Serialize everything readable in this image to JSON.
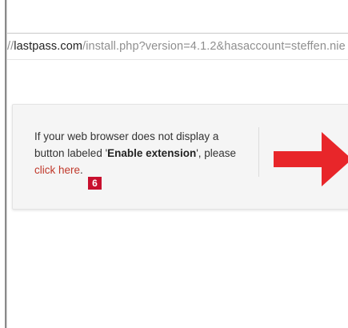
{
  "address_bar": {
    "url_prefix": "//",
    "url_domain": "lastpass.com",
    "url_path": "/install.php?version=4.1.2&hasaccount=steffen.nie"
  },
  "install_panel": {
    "text_1": "If your web browser does not display a button labeled '",
    "bold_label": "Enable extension",
    "text_2": "', please ",
    "link_text": "click here",
    "text_3": ".",
    "badge_number": "6"
  },
  "colors": {
    "link": "#c0392b",
    "arrow": "#e8262a",
    "badge": "#c8102e"
  },
  "icons": {
    "arrow": "right-arrow-icon"
  }
}
